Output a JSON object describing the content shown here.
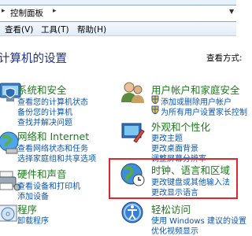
{
  "address": {
    "path": "控制面板",
    "separator": "▸"
  },
  "menu": {
    "items": [
      "查看(V)",
      "工具(T)",
      "帮助(H)"
    ]
  },
  "heading": {
    "title": "计算机的设置",
    "view_mode_label": "查看方式:",
    "view_mode_value": ""
  },
  "categories": {
    "system": {
      "title": "系统和安全",
      "links": [
        "查看您的计算机状态",
        "备份您的计算机",
        "查找并解决问题"
      ]
    },
    "network": {
      "title": "网络和 Internet",
      "links": [
        "查看网络状态和任务",
        "选择家庭组和共享选项"
      ]
    },
    "hardware": {
      "title": "硬件和声音",
      "links": [
        "查看设备和打印机",
        "添加设备"
      ]
    },
    "programs": {
      "title": "程序",
      "links": [
        "卸载程序"
      ]
    },
    "accounts": {
      "title": "用户帐户和家庭安全",
      "links": [
        "添加或删除用户帐户",
        "为所有用户设置家长控制"
      ]
    },
    "appearance": {
      "title": "外观和个性化",
      "links": [
        "更改主题",
        "更改桌面背景",
        "调整屏幕分辨率"
      ]
    },
    "clock": {
      "title": "时钟、语言和区域",
      "links": [
        "更改键盘或其他输入法",
        "更改显示语言"
      ]
    },
    "ease": {
      "title": "轻松访问",
      "links": [
        "使用 Windows 建议的设置",
        "优化视频显示"
      ]
    }
  },
  "colors": {
    "category_title": "#1e7a1e",
    "link": "#0b56ad",
    "heading": "#1e3287",
    "highlight_border": "#e0262b"
  }
}
